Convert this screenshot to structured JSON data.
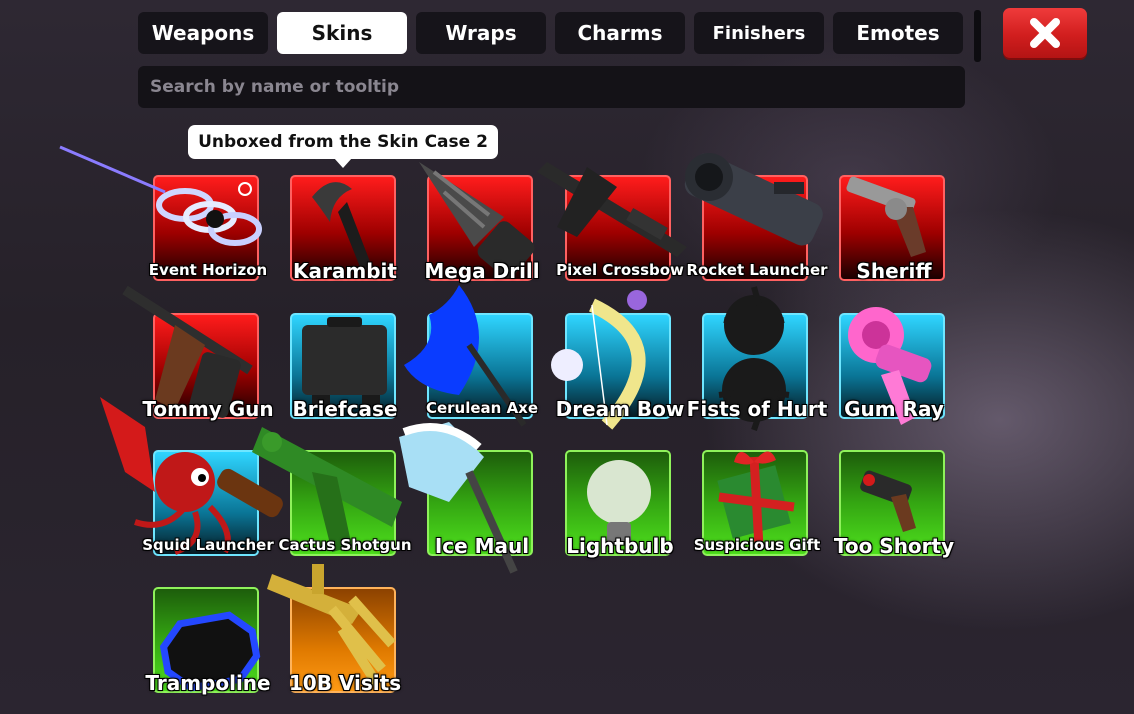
{
  "tabs": [
    "Weapons",
    "Skins",
    "Wraps",
    "Charms",
    "Finishers",
    "Emotes"
  ],
  "active_tab": "Skins",
  "search": {
    "placeholder": "Search by name or tooltip"
  },
  "tooltip": {
    "text": "Unboxed from the Skin Case 2"
  },
  "colors": {
    "rarity_red": "#ff1c1c",
    "rarity_blue": "#2fd5ff",
    "rarity_green": "#4ee01d",
    "rarity_orange": "#ff9a14",
    "close_button": "#e02b2b"
  },
  "items": [
    {
      "name": "Event Horizon",
      "rarity": "red",
      "icon": "event-horizon-icon"
    },
    {
      "name": "Karambit",
      "rarity": "red",
      "icon": "karambit-icon"
    },
    {
      "name": "Mega Drill",
      "rarity": "red",
      "icon": "mega-drill-icon"
    },
    {
      "name": "Pixel Crossbow",
      "rarity": "red",
      "icon": "pixel-crossbow-icon"
    },
    {
      "name": "Rocket Launcher",
      "rarity": "red",
      "icon": "rocket-launcher-icon"
    },
    {
      "name": "Sheriff",
      "rarity": "red",
      "icon": "sheriff-revolver-icon"
    },
    {
      "name": "Tommy Gun",
      "rarity": "red",
      "icon": "tommy-gun-icon"
    },
    {
      "name": "Briefcase",
      "rarity": "blue",
      "icon": "briefcase-icon"
    },
    {
      "name": "Cerulean Axe",
      "rarity": "blue",
      "icon": "cerulean-axe-icon"
    },
    {
      "name": "Dream Bow",
      "rarity": "blue",
      "icon": "dream-bow-icon"
    },
    {
      "name": "Fists of Hurt",
      "rarity": "blue",
      "icon": "fists-of-hurt-icon"
    },
    {
      "name": "Gum Ray",
      "rarity": "blue",
      "icon": "gum-ray-icon"
    },
    {
      "name": "Squid Launcher",
      "rarity": "blue",
      "icon": "squid-launcher-icon"
    },
    {
      "name": "Cactus Shotgun",
      "rarity": "green",
      "icon": "cactus-shotgun-icon"
    },
    {
      "name": "Ice Maul",
      "rarity": "green",
      "icon": "ice-maul-icon"
    },
    {
      "name": "Lightbulb",
      "rarity": "green",
      "icon": "lightbulb-icon"
    },
    {
      "name": "Suspicious Gift",
      "rarity": "green",
      "icon": "suspicious-gift-icon"
    },
    {
      "name": "Too Shorty",
      "rarity": "green",
      "icon": "too-shorty-icon"
    },
    {
      "name": "Trampoline",
      "rarity": "green",
      "icon": "trampoline-icon"
    },
    {
      "name": "10B Visits",
      "rarity": "orange",
      "icon": "10b-visits-icon"
    }
  ]
}
